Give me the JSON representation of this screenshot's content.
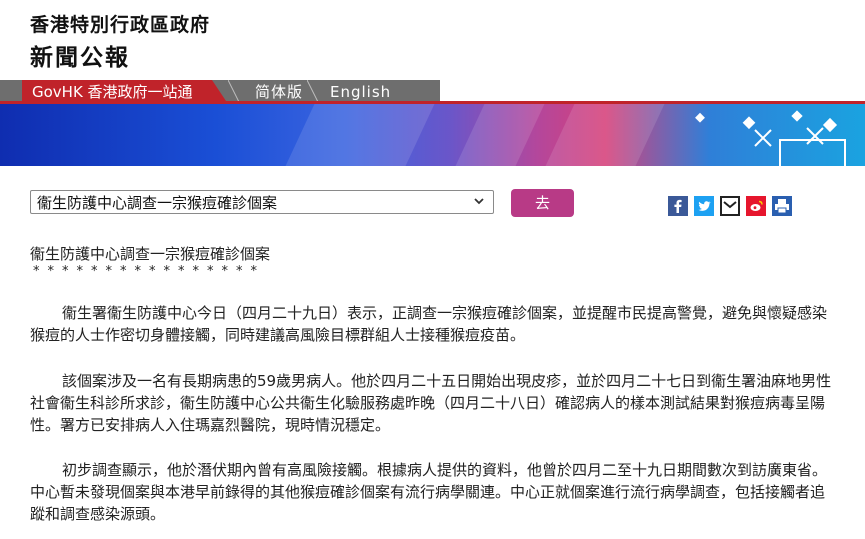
{
  "header": {
    "line1": "香港特別行政區政府",
    "line2": "新聞公報"
  },
  "nav": {
    "govhk": "GovHK 香港政府一站通",
    "simplified": "简体版",
    "english": "English"
  },
  "select": {
    "value": "衞生防護中心調查一宗猴痘確診個案"
  },
  "go_button": "去",
  "icons": [
    "facebook-icon",
    "twitter-icon",
    "email-icon",
    "weibo-icon",
    "print-icon"
  ],
  "colors": {
    "govhk_red": "#c0232a",
    "nav_grey": "#6e6e6e",
    "go_button": "#b83a86"
  },
  "article": {
    "title": "衞生防護中心調查一宗猴痘確診個案",
    "stars": "****************",
    "paragraphs": [
      "衞生署衞生防護中心今日（四月二十九日）表示，正調查一宗猴痘確診個案，並提醒市民提高警覺，避免與懷疑感染猴痘的人士作密切身體接觸，同時建議高風險目標群組人士接種猴痘疫苗。",
      "該個案涉及一名有長期病患的59歲男病人。他於四月二十五日開始出現皮疹，並於四月二十七日到衞生署油麻地男性社會衞生科診所求診，衞生防護中心公共衞生化驗服務處昨晚（四月二十八日）確認病人的樣本測試結果對猴痘病毒呈陽性。署方已安排病人入住瑪嘉烈醫院，現時情況穩定。",
      "初步調查顯示，他於潛伏期內曾有高風險接觸。根據病人提供的資料，他曾於四月二至十九日期間數次到訪廣東省。中心暫未發現個案與本港早前錄得的其他猴痘確診個案有流行病學關連。中心正就個案進行流行病學調查，包括接觸者追蹤和調查感染源頭。"
    ]
  }
}
